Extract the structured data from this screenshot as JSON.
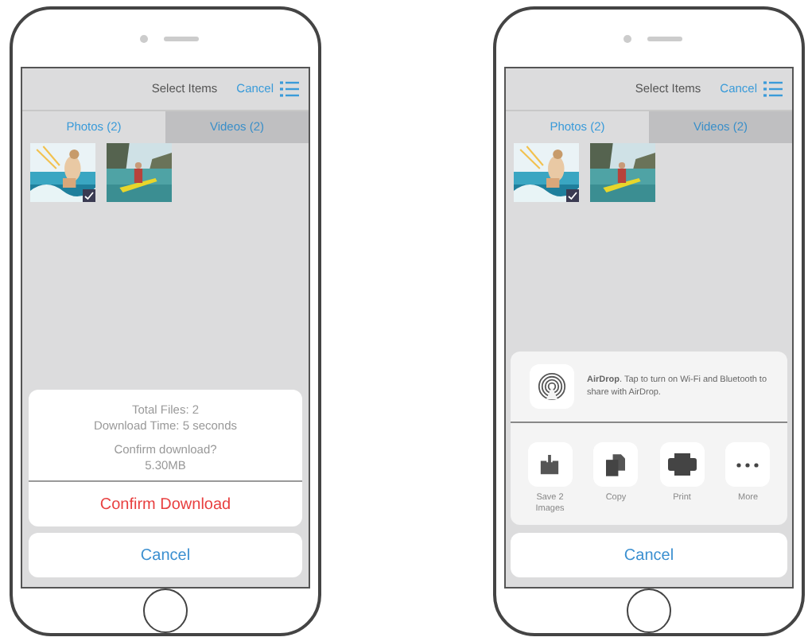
{
  "phones": [
    {
      "header": {
        "title": "Select Items",
        "cancel": "Cancel"
      },
      "tabs": [
        {
          "label": "Photos (2)",
          "selected": true
        },
        {
          "label": "Videos (2)",
          "selected": false
        }
      ],
      "thumbnails": [
        {
          "kind": "picture",
          "selected": true
        },
        {
          "kind": "picture",
          "selected": false
        }
      ],
      "sheet": {
        "kind": "confirm",
        "lines": [
          "Total Files: 2",
          "Download Time: 5 seconds"
        ],
        "question": "Confirm download?",
        "size": "5.30MB",
        "confirm": "Confirm Download",
        "cancel": "Cancel"
      }
    },
    {
      "header": {
        "title": "Select Items",
        "cancel": "Cancel"
      },
      "tabs": [
        {
          "label": "Photos (2)",
          "selected": true
        },
        {
          "label": "Videos (2)",
          "selected": false
        }
      ],
      "thumbnails": [
        {
          "kind": "picture",
          "selected": true
        },
        {
          "kind": "picture",
          "selected": false
        }
      ],
      "sheet": {
        "kind": "share",
        "airdrop": "**AirDrop**. Tap to turn on Wi-Fi and Bluetooth to share with AirDrop.",
        "actions": [
          {
            "kind": "save",
            "label": "Save 2 Images"
          },
          {
            "kind": "copy",
            "label": "Copy"
          },
          {
            "kind": "print",
            "label": "Print"
          },
          {
            "kind": "more",
            "label": "More"
          }
        ],
        "cancel": "Cancel"
      }
    }
  ]
}
